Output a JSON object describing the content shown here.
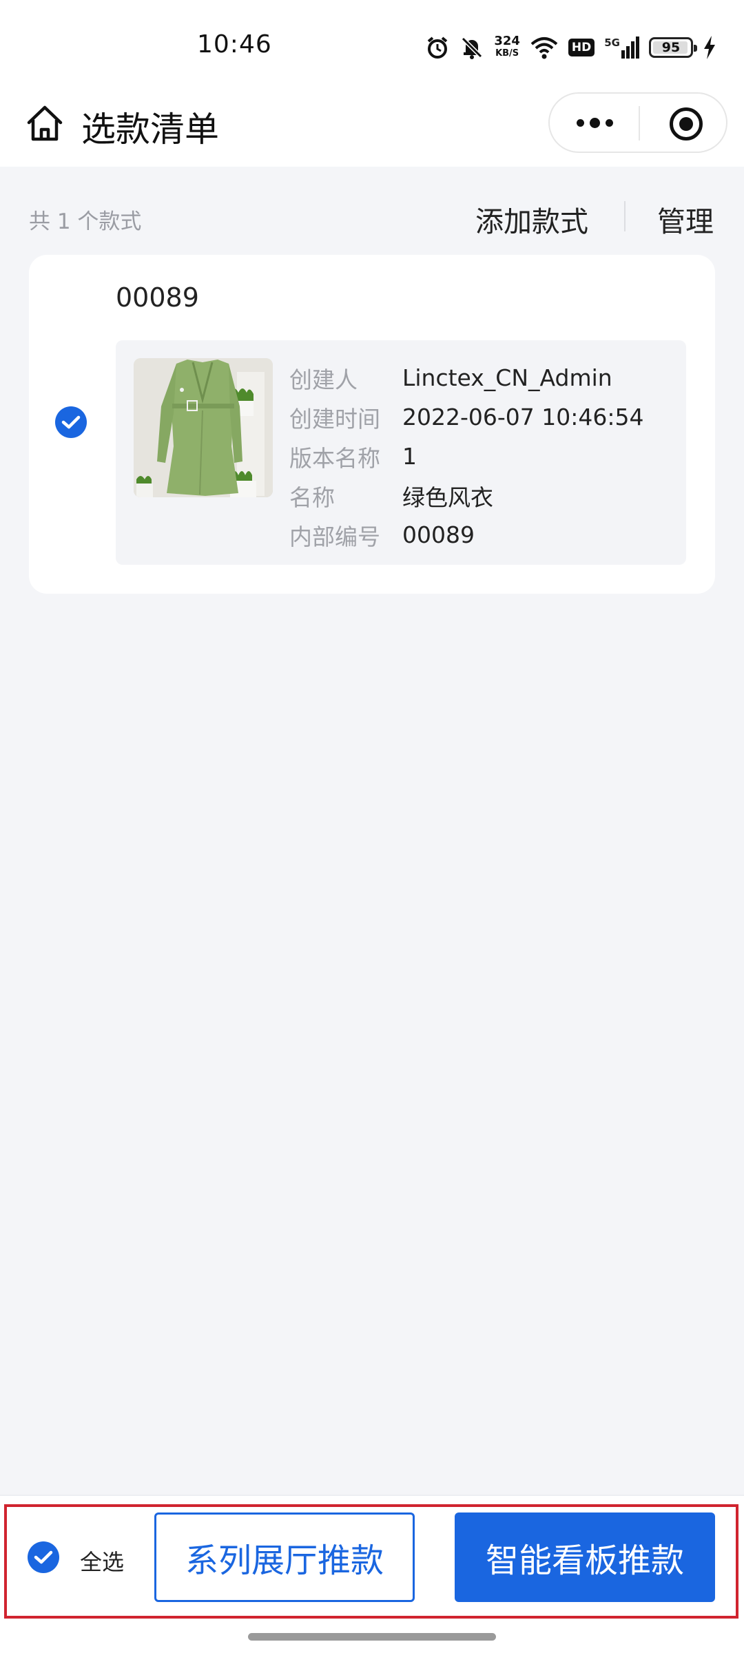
{
  "status_bar": {
    "time": "10:46",
    "net_speed_value": "324",
    "net_speed_unit": "KB/S",
    "hd_label": "HD",
    "network_label": "5G",
    "battery": "95"
  },
  "nav": {
    "title": "选款清单"
  },
  "toolbar": {
    "count_text": "共 1 个款式",
    "add_style_label": "添加款式",
    "manage_label": "管理"
  },
  "items": [
    {
      "code": "00089",
      "checked": true,
      "fields": [
        {
          "label": "创建人",
          "value": "Linctex_CN_Admin"
        },
        {
          "label": "创建时间",
          "value": "2022-06-07 10:46:54"
        },
        {
          "label": "版本名称",
          "value": "1"
        },
        {
          "label": "名称",
          "value": "绿色风衣"
        },
        {
          "label": "内部编号",
          "value": "00089"
        }
      ]
    }
  ],
  "bottom_bar": {
    "select_all_label": "全选",
    "series_showroom_button": "系列展厅推款",
    "smart_board_button": "智能看板推款"
  },
  "colors": {
    "accent": "#1a66e0",
    "highlight_border": "#d0242f",
    "page_background": "#f4f5f8"
  }
}
